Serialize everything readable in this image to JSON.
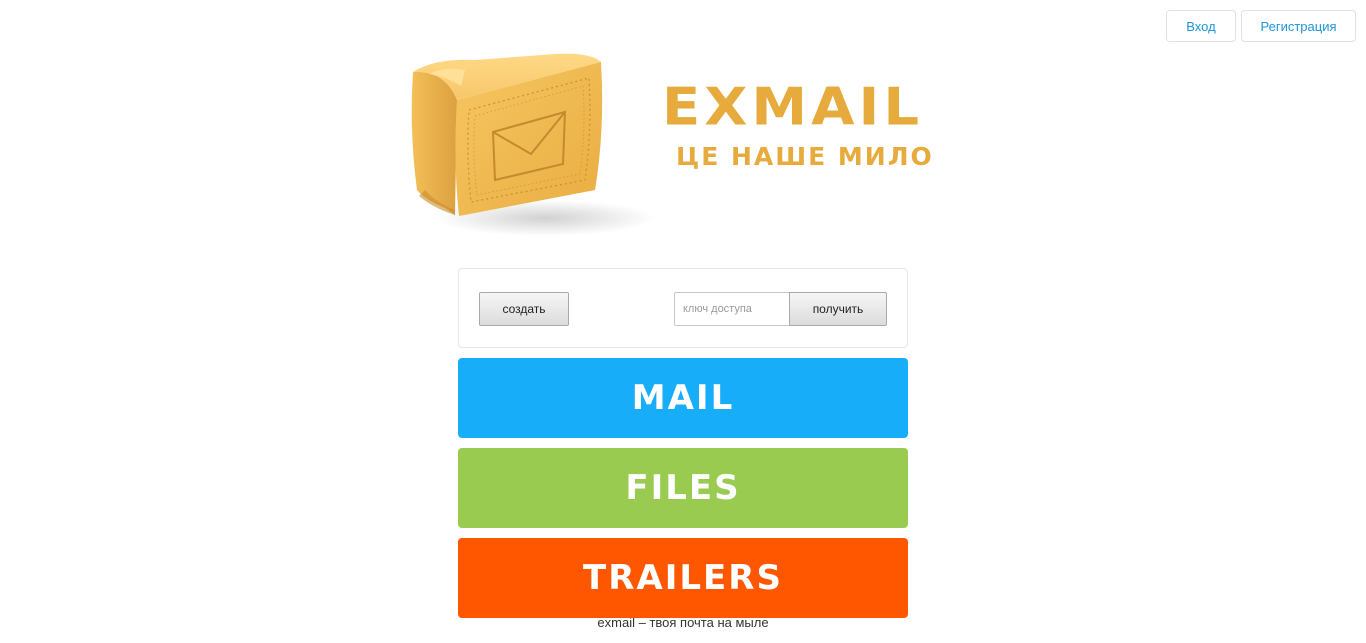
{
  "header": {
    "login_label": "Вход",
    "register_label": "Регистрация"
  },
  "hero": {
    "logo_text": "EXMAIL",
    "slogan": "ЦЕ НАШЕ МИЛО",
    "image_icon": "soap-envelope-icon"
  },
  "access_panel": {
    "create_label": "создать",
    "key_placeholder": "ключ доступа",
    "key_value": "",
    "get_label": "получить"
  },
  "tiles": {
    "mail": "MAIL",
    "files": "FILES",
    "trailers": "TRAILERS"
  },
  "colors": {
    "brand": "#e6ab3c",
    "mail": "#18adf8",
    "files": "#98cb4f",
    "trailers": "#ff5600",
    "link": "#1e96d8"
  },
  "footer": {
    "note": "exmail – твоя почта на мыле"
  }
}
